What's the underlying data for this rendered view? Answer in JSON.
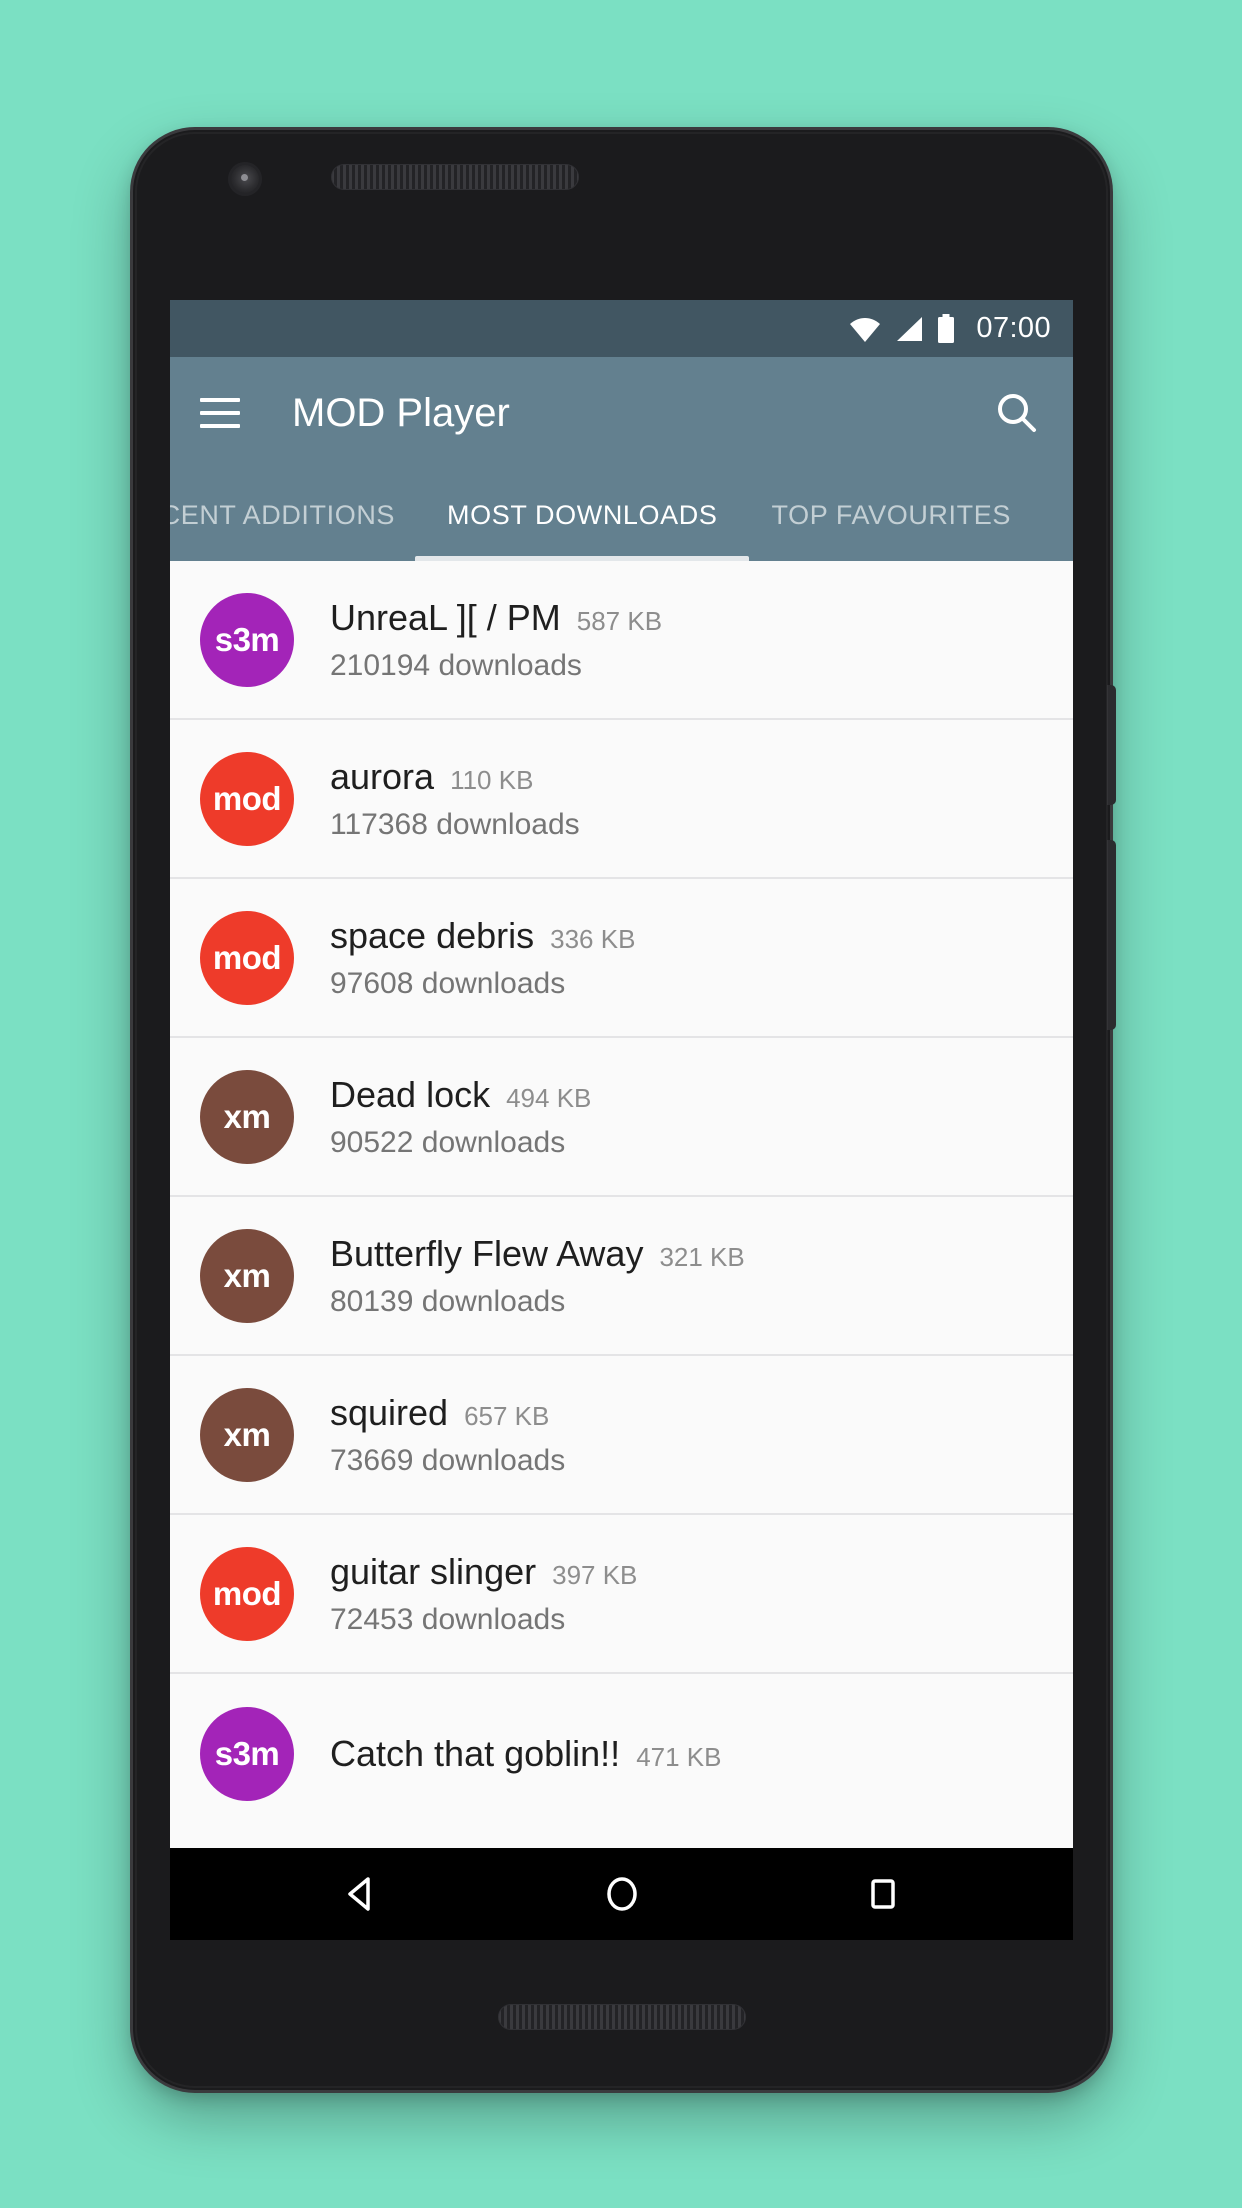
{
  "background_color": "#7BE0C3",
  "status_bar": {
    "icons": [
      "wifi-icon",
      "cellular-signal-icon",
      "battery-icon"
    ],
    "clock": "07:00",
    "background": "#415662"
  },
  "app_bar": {
    "menu_icon": "hamburger-menu-icon",
    "title": "MOD Player",
    "search_icon": "search-icon",
    "background": "#63808F"
  },
  "tabs": {
    "items": [
      {
        "label": "ECENT ADDITIONS",
        "active": false
      },
      {
        "label": "MOST DOWNLOADS",
        "active": true
      },
      {
        "label": "TOP FAVOURITES",
        "active": false
      }
    ],
    "active_index": 1,
    "indicator_color": "#e3e7ea"
  },
  "list": {
    "rows": [
      {
        "badge": "s3m",
        "badge_color": "#A324B8",
        "title": "UnreaL ][ / PM",
        "size": "587 KB",
        "downloads": "210194 downloads"
      },
      {
        "badge": "mod",
        "badge_color": "#EE3B2A",
        "title": "aurora",
        "size": "110 KB",
        "downloads": "117368 downloads"
      },
      {
        "badge": "mod",
        "badge_color": "#EE3B2A",
        "title": "space debris",
        "size": "336 KB",
        "downloads": "97608 downloads"
      },
      {
        "badge": "xm",
        "badge_color": "#7A4B3D",
        "title": "Dead lock",
        "size": "494 KB",
        "downloads": "90522 downloads"
      },
      {
        "badge": "xm",
        "badge_color": "#7A4B3D",
        "title": "Butterfly Flew Away",
        "size": "321 KB",
        "downloads": "80139 downloads"
      },
      {
        "badge": "xm",
        "badge_color": "#7A4B3D",
        "title": "squired",
        "size": "657 KB",
        "downloads": "73669 downloads"
      },
      {
        "badge": "mod",
        "badge_color": "#EE3B2A",
        "title": "guitar slinger",
        "size": "397 KB",
        "downloads": "72453 downloads"
      },
      {
        "badge": "s3m",
        "badge_color": "#A324B8",
        "title": "Catch that goblin!!",
        "size": "471 KB",
        "downloads": ""
      }
    ]
  },
  "nav_bar": {
    "buttons": [
      {
        "icon": "back-triangle-icon"
      },
      {
        "icon": "home-circle-icon"
      },
      {
        "icon": "recents-square-icon"
      }
    ],
    "background": "#000000"
  }
}
